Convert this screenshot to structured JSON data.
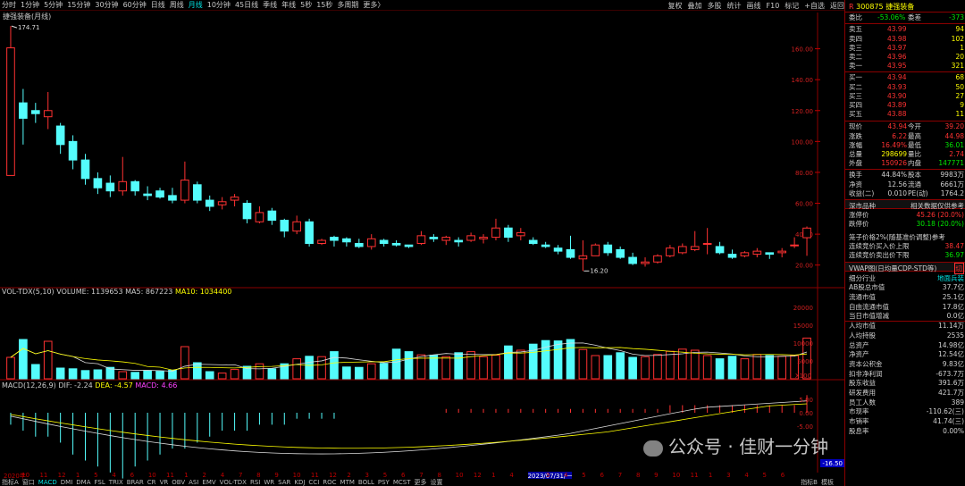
{
  "topbar": {
    "periods": [
      "分时",
      "1分钟",
      "5分钟",
      "15分钟",
      "30分钟",
      "60分钟",
      "日线",
      "周线",
      "月线",
      "10分钟",
      "45日线",
      "季线",
      "年线",
      "5秒",
      "15秒",
      "多周期",
      "更多〉"
    ],
    "active_period": "月线",
    "right_buttons": [
      "复权",
      "叠加",
      "多股",
      "统计",
      "画线",
      "F10",
      "标记",
      "+自选",
      "返回"
    ]
  },
  "stock_title": "捷强装备(月线)",
  "price_axis": [
    "160.00",
    "140.00",
    "120.00",
    "100.00",
    "80.00",
    "60.00",
    "40.00",
    "20.00"
  ],
  "high_label": "174.71",
  "low_label": "16.20",
  "volume": {
    "legend_name": "VOL-TDX(5,10)",
    "legend_volume": "VOLUME: 1139653",
    "legend_ma5": "MA5: 867223",
    "legend_ma10": "MA10: 1034400",
    "axis": [
      "20000",
      "15000",
      "10000",
      "5000"
    ],
    "axis_unit": "X100"
  },
  "macd": {
    "legend_name": "MACD(12,26,9)",
    "legend_dif": "DIF: -2.24",
    "legend_dea": "DEA: -4.57",
    "legend_macd": "MACD: 4.66",
    "axis": [
      "5.00",
      "0.00",
      "-5.00"
    ],
    "current": "-16.50"
  },
  "xaxis": [
    "2020年",
    "10",
    "11",
    "12",
    "1",
    "5",
    "4",
    "6",
    "10",
    "11",
    "1",
    "2",
    "4",
    "7",
    "8",
    "9",
    "10",
    "11",
    "12",
    "2",
    "3",
    "5",
    "6",
    "7",
    "8",
    "10",
    "12",
    "1",
    "4",
    "2023/07/31/一",
    "3",
    "4",
    "5",
    "6",
    "7",
    "8",
    "9",
    "10",
    "11",
    "1",
    "3",
    "4",
    "5",
    "6"
  ],
  "bottom_tabs": [
    "指标A",
    "窗口",
    "MACD",
    "DMI",
    "DMA",
    "FSL",
    "TRIX",
    "BRAR",
    "CR",
    "VR",
    "OBV",
    "ASI",
    "EMV",
    "VOL-TDX",
    "RSI",
    "WR",
    "SAR",
    "KDJ",
    "CCI",
    "ROC",
    "MTM",
    "BOLL",
    "PSY",
    "MCST",
    "更多",
    "设置"
  ],
  "bottom_active": "MACD",
  "bottom_right": [
    "指标B",
    "模板"
  ],
  "panel": {
    "code": "300875",
    "name": "捷强装备",
    "weibi_label": "委比",
    "weibi": "-53.06%",
    "weicha_label": "委差",
    "weicha": "-373",
    "asks": [
      {
        "label": "卖五",
        "price": "43.99",
        "vol": "94"
      },
      {
        "label": "卖四",
        "price": "43.98",
        "vol": "102"
      },
      {
        "label": "卖三",
        "price": "43.97",
        "vol": "1"
      },
      {
        "label": "卖二",
        "price": "43.96",
        "vol": "20"
      },
      {
        "label": "卖一",
        "price": "43.95",
        "vol": "321"
      }
    ],
    "bids": [
      {
        "label": "买一",
        "price": "43.94",
        "vol": "68"
      },
      {
        "label": "买二",
        "price": "43.93",
        "vol": "50"
      },
      {
        "label": "买三",
        "price": "43.90",
        "vol": "27"
      },
      {
        "label": "买四",
        "price": "43.89",
        "vol": "9"
      },
      {
        "label": "买五",
        "price": "43.88",
        "vol": "11"
      }
    ],
    "quote": [
      {
        "l1": "现价",
        "v1": "43.94",
        "l2": "今开",
        "v2": "39.20",
        "c1": "red",
        "c2": "red"
      },
      {
        "l1": "涨跌",
        "v1": "6.22",
        "l2": "最高",
        "v2": "44.98",
        "c1": "red",
        "c2": "red"
      },
      {
        "l1": "涨幅",
        "v1": "16.49%",
        "l2": "最低",
        "v2": "36.01",
        "c1": "red",
        "c2": "green"
      },
      {
        "l1": "总量",
        "v1": "298699",
        "l2": "量比",
        "v2": "2.74",
        "c1": "yel",
        "c2": "red"
      },
      {
        "l1": "外盘",
        "v1": "150926",
        "l2": "内盘",
        "v2": "147771",
        "c1": "red",
        "c2": "green"
      }
    ],
    "fin": [
      {
        "l1": "换手",
        "v1": "44.84%",
        "l2": "股本",
        "v2": "9983万"
      },
      {
        "l1": "净资",
        "v1": "12.56",
        "l2": "流通",
        "v2": "6661万"
      },
      {
        "l1": "收益(二)",
        "v1": "0.010",
        "l2": "PE(动)",
        "v2": "1764.2"
      }
    ],
    "market_title": "深市品种",
    "market_note": "相关数据仅供参考",
    "limit_up_label": "涨停价",
    "limit_up": "45.26 (20.0%)",
    "limit_down_label": "跌停价",
    "limit_down": "30.18 (20.0%)",
    "cage_note": "笼子价格2%(随基准价调整)参考",
    "cage_up_label": "连续竞价买入价上限",
    "cage_up": "38.47",
    "cage_down_label": "连续竞价卖出价下限",
    "cage_down": "36.97",
    "vwap_title": "VWAP图(日均量CDP-STD等)",
    "vwap_btn": "切",
    "industry_label": "细分行业",
    "industry": "地面兵装",
    "stats": [
      {
        "l": "AB股总市值",
        "v": "37.7亿"
      },
      {
        "l": "流通市值",
        "v": "25.1亿"
      },
      {
        "l": "自由流通市值",
        "v": "17.8亿"
      },
      {
        "l": "当日市值增减",
        "v": "0.0亿"
      },
      {
        "l": "人均市值",
        "v": "11.14万"
      },
      {
        "l": "人均持股",
        "v": "2535"
      },
      {
        "l": "总资产",
        "v": "14.98亿"
      },
      {
        "l": "净资产",
        "v": "12.54亿"
      },
      {
        "l": "资本公积金",
        "v": "9.83亿"
      },
      {
        "l": "扣非净利润",
        "v": "-673.7万"
      },
      {
        "l": "股东收益",
        "v": "391.6万"
      },
      {
        "l": "研发费用",
        "v": "421.7万"
      },
      {
        "l": "员工人数",
        "v": "389"
      },
      {
        "l": "市现率",
        "v": "-110.62(三)"
      },
      {
        "l": "市销率",
        "v": "41.74(三)"
      },
      {
        "l": "股息率",
        "v": "0.00%"
      }
    ]
  },
  "watermark": "公众号 · 佳财一分钟",
  "chart_data": {
    "type": "candlestick",
    "candles": [
      [
        78,
        174.71,
        102,
        160.6
      ],
      [
        125,
        134,
        98,
        115
      ],
      [
        120,
        125,
        112,
        118
      ],
      [
        116,
        132,
        108,
        120
      ],
      [
        110,
        112,
        92,
        98
      ],
      [
        100,
        104,
        82,
        88
      ],
      [
        88,
        92,
        72,
        76
      ],
      [
        76,
        80,
        66,
        70
      ],
      [
        73,
        78,
        64,
        68
      ],
      [
        68,
        90,
        65,
        74
      ],
      [
        74,
        75,
        65,
        68
      ],
      [
        66,
        71,
        62,
        65
      ],
      [
        68,
        70,
        63,
        64
      ],
      [
        65,
        70,
        60,
        62
      ],
      [
        62,
        87,
        60,
        75
      ],
      [
        72,
        74,
        60,
        62
      ],
      [
        62,
        65,
        55,
        58
      ],
      [
        59,
        64,
        56,
        61
      ],
      [
        62,
        66,
        58,
        64
      ],
      [
        60,
        62,
        47,
        50
      ],
      [
        48,
        58,
        47,
        54
      ],
      [
        55,
        57,
        46,
        49
      ],
      [
        49,
        50,
        38,
        42
      ],
      [
        42,
        52,
        40,
        48
      ],
      [
        48,
        50,
        32,
        34
      ],
      [
        34,
        37,
        33,
        36
      ],
      [
        38,
        39,
        32,
        36
      ],
      [
        37,
        38,
        32,
        35
      ],
      [
        34,
        37,
        31,
        32
      ],
      [
        32,
        40,
        30,
        37
      ],
      [
        36,
        37,
        32,
        34
      ],
      [
        34,
        36,
        32,
        33
      ],
      [
        33,
        33,
        31,
        32
      ],
      [
        34,
        42,
        33,
        39
      ],
      [
        38,
        40,
        35,
        37
      ],
      [
        36,
        39,
        33,
        38
      ],
      [
        36,
        38,
        32,
        35
      ],
      [
        36,
        41,
        35,
        39
      ],
      [
        37,
        40,
        34,
        38
      ],
      [
        38,
        50,
        36,
        44
      ],
      [
        44,
        46,
        35,
        38
      ],
      [
        39,
        44,
        36,
        41
      ],
      [
        36,
        38,
        33,
        34
      ],
      [
        33,
        35,
        31,
        32
      ],
      [
        31,
        33,
        27,
        29
      ],
      [
        30,
        39,
        24,
        25
      ],
      [
        24,
        36,
        16.2,
        26
      ],
      [
        26,
        34,
        26,
        33
      ],
      [
        33,
        35,
        26,
        28
      ],
      [
        30,
        32,
        24,
        25
      ],
      [
        25,
        28,
        20,
        21
      ],
      [
        21,
        25,
        19,
        22
      ],
      [
        22,
        27,
        21,
        26
      ],
      [
        26,
        33,
        25,
        31
      ],
      [
        28,
        34,
        27,
        32
      ],
      [
        30,
        42,
        29,
        32
      ],
      [
        34,
        44,
        27,
        34
      ],
      [
        32,
        35,
        27,
        28
      ],
      [
        27,
        30,
        24,
        25
      ],
      [
        26,
        29,
        25,
        28
      ],
      [
        27,
        31,
        25,
        29
      ],
      [
        28,
        28,
        24,
        27
      ],
      [
        28,
        31,
        25,
        29
      ],
      [
        33,
        38,
        31,
        33
      ],
      [
        37.72,
        44.98,
        26,
        43.94
      ]
    ],
    "volume": [
      6000,
      11000,
      4000,
      10500,
      3000,
      2800,
      2300,
      2500,
      3200,
      2000,
      1800,
      2300,
      2100,
      2400,
      9000,
      4500,
      2000,
      1600,
      2600,
      3500,
      4200,
      2800,
      4200,
      5600,
      6300,
      6200,
      7600,
      3300,
      3200,
      4200,
      4300,
      8300,
      7600,
      6700,
      6600,
      6200,
      7300,
      7600,
      6200,
      6600,
      9200,
      8000,
      9700,
      10700,
      10600,
      11000,
      8200,
      6500,
      6500,
      7300,
      6000,
      6200,
      6800,
      7700,
      8300,
      8000,
      6500,
      5600,
      6300,
      5600,
      6800,
      6500,
      6300,
      6500,
      11400
    ],
    "macd_hist": [
      -2,
      -3,
      -4,
      -4,
      -5,
      -7,
      -8,
      -9,
      -10,
      -11,
      -9,
      -8,
      -7,
      -6,
      -6,
      -5,
      -4,
      -3,
      -3,
      -3,
      -2,
      -2,
      -2,
      -1,
      -1,
      -1,
      -1,
      0,
      0,
      0,
      0,
      0,
      0,
      0,
      0,
      1,
      1,
      1,
      1,
      1,
      1,
      1,
      1,
      1,
      1,
      1,
      1,
      1,
      1,
      1,
      1,
      1,
      1,
      2,
      2,
      2,
      2,
      2,
      2,
      2,
      2,
      2,
      2,
      2,
      4.66
    ],
    "ylim": [
      10,
      180
    ],
    "vol_max": 22000
  }
}
